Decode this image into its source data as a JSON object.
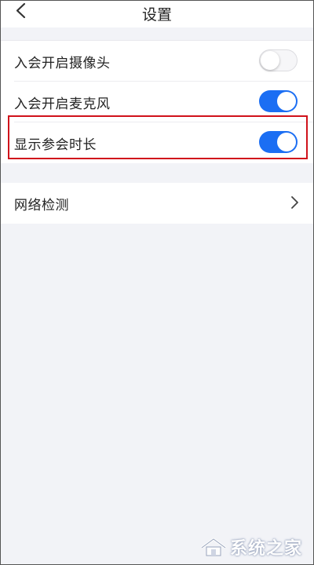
{
  "header": {
    "title": "设置",
    "back_icon": "chevron-left-icon"
  },
  "settings": {
    "camera_on_join": {
      "label": "入会开启摄像头",
      "enabled": false
    },
    "mic_on_join": {
      "label": "入会开启麦克风",
      "enabled": true
    },
    "show_duration": {
      "label": "显示参会时长",
      "enabled": true
    }
  },
  "network": {
    "label": "网络检测",
    "icon": "chevron-right-icon"
  },
  "watermark": {
    "text": "系统之家"
  },
  "colors": {
    "toggle_on": "#1b6ef3",
    "highlight_border": "#d0121b",
    "page_background": "#f2f3f7"
  }
}
